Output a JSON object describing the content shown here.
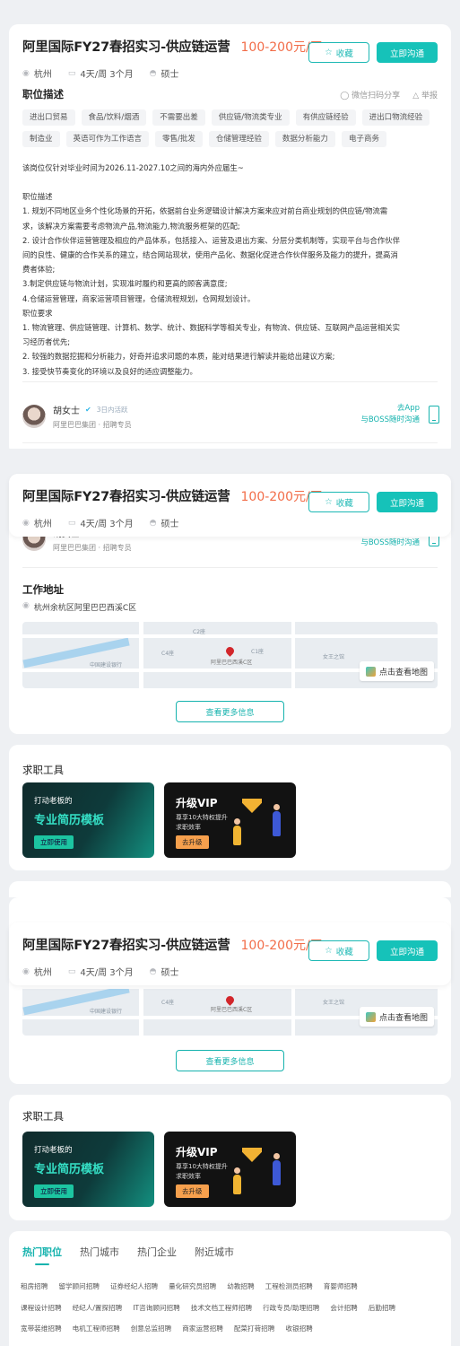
{
  "job": {
    "title": "阿里国际FY27春招实习-供应链运营",
    "salary": "100-200元/天",
    "city": "杭州",
    "schedule": "4天/周 3个月",
    "degree": "硕士",
    "fav_label": "收藏",
    "chat_label": "立即沟通"
  },
  "description": {
    "heading": "职位描述",
    "share_label": "微信扫码分享",
    "report_label": "举报",
    "tags_row1": [
      "进出口贸易",
      "食品/饮料/烟酒",
      "不需要出差",
      "供应链/物流类专业",
      "有供应链经验",
      "进出口物流经验"
    ],
    "tags_row2": [
      "制造业",
      "英语可作为工作语言",
      "零售/批发",
      "仓储管理经验",
      "数据分析能力",
      "电子商务"
    ],
    "intro": "该岗位仅针对毕业时间为2026.11-2027.10之间的海内外应届生~",
    "lines": [
      "职位描述",
      "1. 规划不同地区业务个性化场景的开拓，依据前台业务逻辑设计解决方案来应对前台商业规划的供应链/物流需",
      "求，该解决方案需要考虑物流产品,物流能力,物流服务框架的匹配;",
      "2. 设计合作伙伴运营管理及相应的产品体系，包括接入、运营及退出方案、分层分类机制等，实现平台与合作伙伴",
      "间的良性、健康的合作关系的建立，结合网站现状，使用产品化、数据化促进合作伙伴服务及能力的提升，提高消",
      "费者体验;",
      "3.制定供应链与物流计划，实现准时履约和更高的顾客满意度;",
      "4.仓储运营管理，商家运营项目管理，仓储流程规划，仓网规划设计。",
      "职位要求",
      "1. 物流管理、供应链管理、计算机、数学、统计、数据科学等相关专业，有物流、供应链、互联网产品运营相关实",
      "习经历者优先;",
      "2. 较强的数据挖掘和分析能力，好奇并追求问题的本质，能对结果进行解读并能给出建议方案;",
      "3. 接受快节奏变化的环境以及良好的适应调整能力。"
    ]
  },
  "recruiter": {
    "name": "胡女士",
    "active": "3日内活跃",
    "company": "阿里巴巴集团 · 招聘专员",
    "app_line1": "去App",
    "app_line2": "与BOSS随时沟通"
  },
  "location": {
    "heading": "工作地址",
    "address": "杭州余杭区阿里巴巴西溪C区",
    "map_button": "点击查看地图",
    "map_place": "阿里巴巴西溪C区",
    "map_labels": [
      "C2座",
      "C3座",
      "C4座",
      "C1座",
      "C5座",
      "中国建设银行",
      "建筑设计",
      "女王之馆"
    ],
    "more_button": "查看更多信息"
  },
  "tools": {
    "heading": "求职工具",
    "resume_line1": "打动老板的",
    "resume_line2": "专业简历模板",
    "resume_button": "立即使用",
    "vip_title": "升级VIP",
    "vip_sub": "尊享10大特权提升求职效率",
    "vip_button": "去升级"
  },
  "footer": {
    "tabs": [
      "热门职位",
      "热门城市",
      "热门企业",
      "附近城市"
    ],
    "links_row1": [
      "租房招聘",
      "留学顾问招聘",
      "证券经纪人招聘",
      "量化研究员招聘",
      "幼教招聘",
      "工程检测员招聘",
      "育婴师招聘"
    ],
    "links_row2": [
      "课程设计招聘",
      "经纪人/置探招聘",
      "IT咨询顾问招聘",
      "技术文档工程师招聘",
      "行政专员/助理招聘",
      "会计招聘",
      "后勤招聘"
    ],
    "links_row3": [
      "宽带装维招聘",
      "电机工程师招聘",
      "创意总监招聘",
      "商家运营招聘",
      "配菜打荷招聘",
      "收银招聘"
    ]
  }
}
